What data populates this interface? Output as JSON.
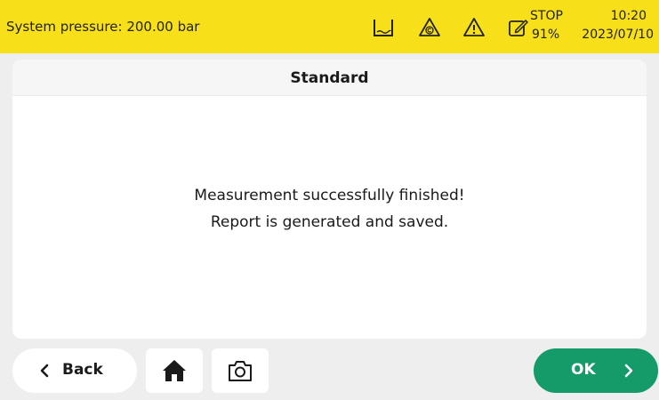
{
  "status_bar": {
    "pressure_text": "System pressure: 200.00 bar",
    "icons": [
      "basin-icon",
      "copyright-warning-icon",
      "warning-icon",
      "edit-note-icon"
    ],
    "stop_label": "STOP",
    "stop_percent": "91%",
    "time": "10:20",
    "date": "2023/07/10",
    "background_color": "#f7e01a"
  },
  "panel": {
    "title": "Standard",
    "message_line1": "Measurement successfully finished!",
    "message_line2": "Report is generated and saved."
  },
  "footer": {
    "back_label": "Back",
    "home_icon": "home-icon",
    "camera_icon": "camera-icon",
    "ok_label": "OK",
    "ok_color": "#159a6a"
  }
}
